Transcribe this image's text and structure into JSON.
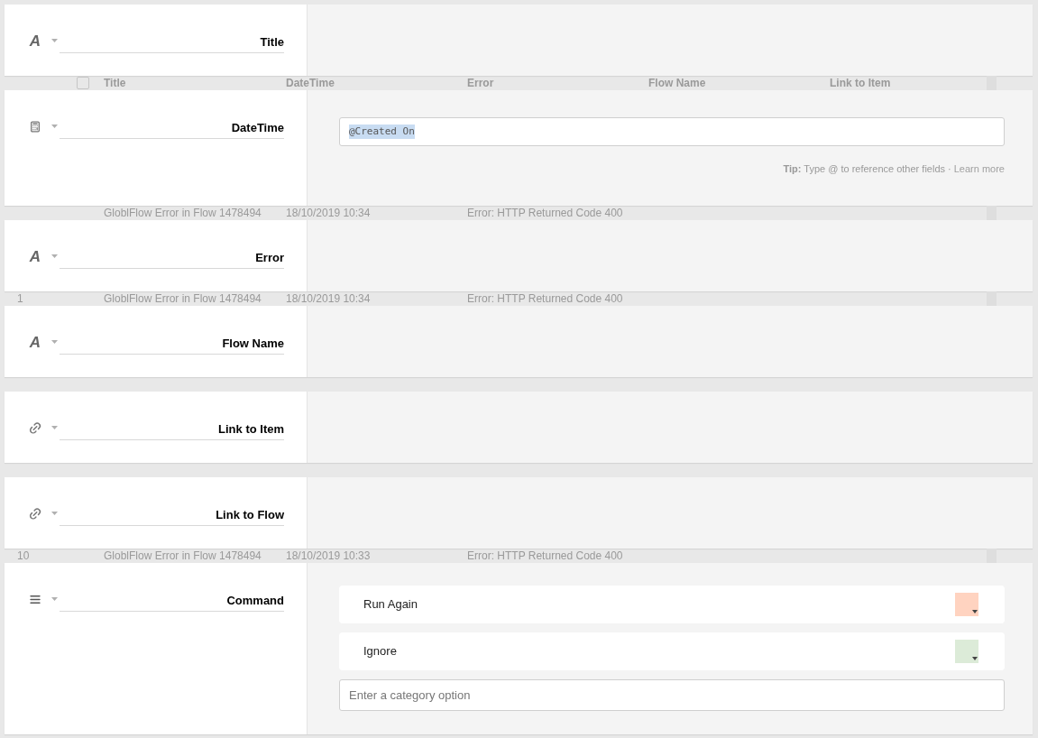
{
  "background_strips": [
    {
      "kind": "header",
      "checked": false,
      "cells": [
        "Title",
        "DateTime",
        "Error",
        "Flow Name",
        "Link to Item"
      ]
    },
    {
      "kind": "row",
      "cells": [
        "GloblFlow Error in Flow 1478494",
        "18/10/2019 10:34",
        "Error: HTTP Returned Code 400"
      ]
    },
    {
      "kind": "row",
      "number": "1",
      "cells": [
        "GloblFlow Error in Flow 1478494",
        "18/10/2019 10:34",
        "Error: HTTP Returned Code 400"
      ]
    },
    {
      "kind": "blank"
    },
    {
      "kind": "blank"
    },
    {
      "kind": "row",
      "number": "10",
      "cells": [
        "GloblFlow Error in Flow 1478494",
        "18/10/2019 10:33",
        "Error: HTTP Returned Code 400"
      ]
    }
  ],
  "fields": [
    {
      "kind": "text",
      "icon_char": "A",
      "label": "Title"
    },
    {
      "kind": "date",
      "label": "DateTime",
      "formula": {
        "value": "@Created On",
        "selected": true
      },
      "tip": "**Tip:** Type @ to reference other fields · ",
      "tip_link": "Learn more"
    },
    {
      "kind": "text",
      "icon_char": "A",
      "label": "Error"
    },
    {
      "kind": "text",
      "icon_char": "A",
      "label": "Flow Name"
    },
    {
      "kind": "link",
      "label": "Link to Item"
    },
    {
      "kind": "link",
      "label": "Link to Flow"
    },
    {
      "kind": "command",
      "label": "Command",
      "options": [
        {
          "label": "Run Again",
          "color": "#ffd3c0"
        },
        {
          "label": "Ignore",
          "color": "#dcebd8"
        }
      ],
      "new_option_placeholder": "Enter a category option"
    }
  ]
}
